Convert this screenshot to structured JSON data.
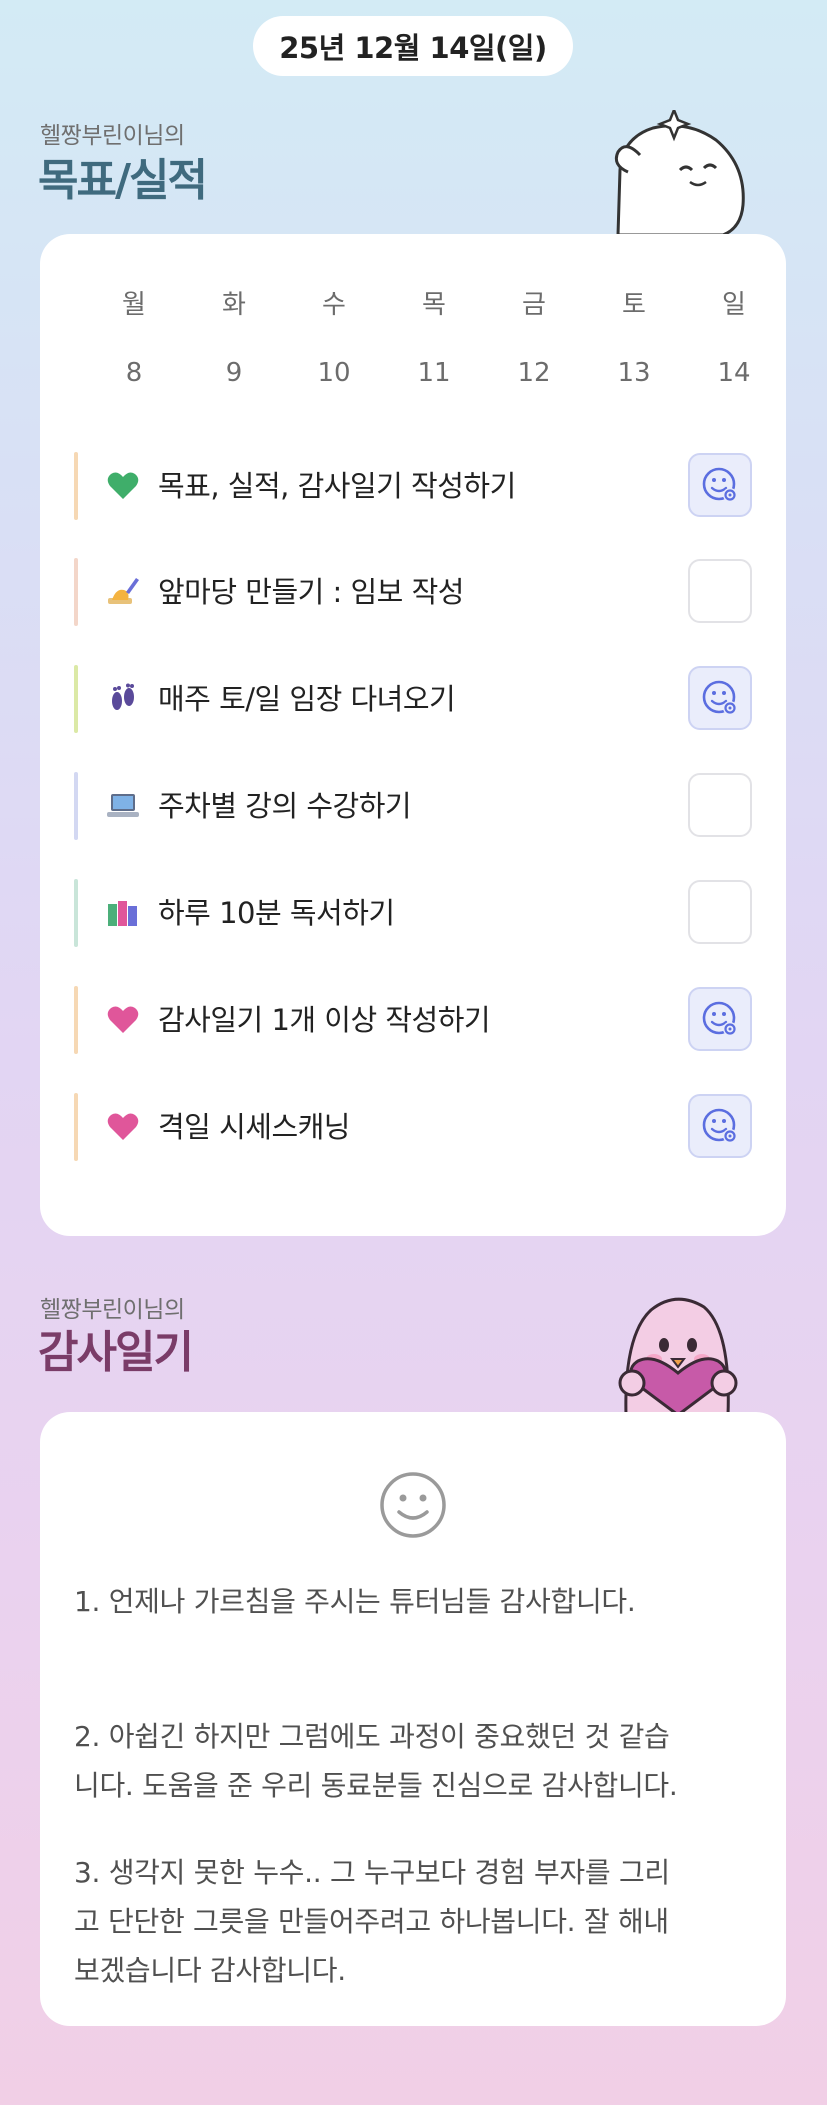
{
  "header": {
    "date": "25년 12월 14일(일)"
  },
  "goals_section": {
    "owner": "헬짱부린이님의",
    "title": "목표/실적"
  },
  "week": {
    "days": [
      "월",
      "화",
      "수",
      "목",
      "금",
      "토",
      "일"
    ],
    "dates": [
      "8",
      "9",
      "10",
      "11",
      "12",
      "13",
      "14"
    ]
  },
  "goals": [
    {
      "icon": "green-heart-icon",
      "label": "목표, 실적, 감사일기 작성하기",
      "done": true,
      "bar_color": "#f6d8b4"
    },
    {
      "icon": "writing-hand-icon",
      "label": "앞마당 만들기 : 임보 작성",
      "done": false,
      "bar_color": "#f3d6c9"
    },
    {
      "icon": "footprints-icon",
      "label": "매주 토/일 임장 다녀오기",
      "done": true,
      "bar_color": "#dbe9a6"
    },
    {
      "icon": "laptop-icon",
      "label": "주차별 강의 수강하기",
      "done": false,
      "bar_color": "#d3d8f2"
    },
    {
      "icon": "books-icon",
      "label": "하루 10분 독서하기",
      "done": false,
      "bar_color": "#c9e5d9"
    },
    {
      "icon": "pink-heart-icon",
      "label": "감사일기 1개 이상 작성하기",
      "done": true,
      "bar_color": "#f6d8b4"
    },
    {
      "icon": "pink-heart-icon",
      "label": "격일 시세스캐닝",
      "done": true,
      "bar_color": "#f6d8b4"
    }
  ],
  "gratitude_section": {
    "owner": "헬짱부린이님의",
    "title": "감사일기"
  },
  "gratitude": {
    "icon": "smiley-face-icon",
    "paragraphs": [
      [
        "1. 언제나 가르침을 주시는 튜터님들 감사합니다."
      ],
      [
        "2. 아쉽긴 하지만 그럼에도 과정이 중요했던 것 같습",
        "니다. 도움을 준 우리 동료분들 진심으로 감사합니다."
      ],
      [
        "3. 생각지 못한 누수.. 그 누구보다 경험 부자를 그리",
        "고 단단한 그릇을 만들어주려고 하나봅니다. 잘 해내",
        "보겠습니다 감사합니다."
      ]
    ]
  },
  "colors": {
    "goals_title": "#3f6a7e",
    "gratitude_title": "#7a3c68",
    "check_accent": "#5b6ee0"
  }
}
